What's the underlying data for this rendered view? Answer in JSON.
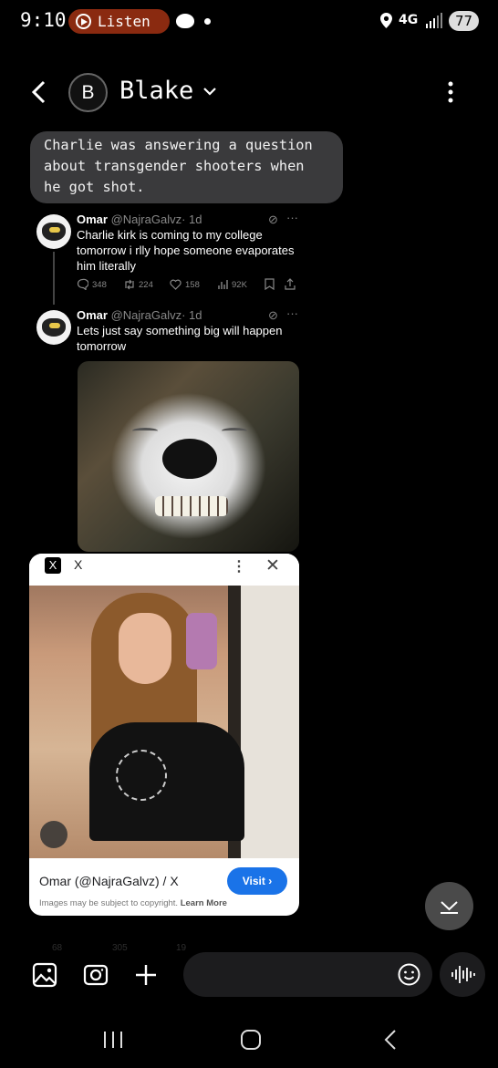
{
  "status_bar": {
    "time": "9:10",
    "listen_label": "Listen",
    "network": "4G",
    "battery": "77",
    "listen_color": "#8a2a10"
  },
  "header": {
    "avatar_letter": "B",
    "contact_name": "Blake"
  },
  "message": {
    "text": "Charlie was answering a question about transgender shooters when he got shot."
  },
  "tweets": [
    {
      "name": "Omar",
      "handle": "@NajraGalvz",
      "age": "· 1d",
      "text": "Charlie kirk is coming to my college tomorrow i rlly hope someone evaporates him literally",
      "replies": "348",
      "reposts": "224",
      "likes": "158",
      "views": "92K"
    },
    {
      "name": "Omar",
      "handle": "@NajraGalvz",
      "age": "· 1d",
      "text": "Lets just say something big will happen tomorrow"
    }
  ],
  "lens_card": {
    "logo": "X",
    "source": "X",
    "title": "Omar (@NajraGalvz) / X",
    "visit_label": "Visit ›",
    "copyright": "Images may be subject to copyright.",
    "learn_more": "Learn More"
  },
  "ghost_row": {
    "replies": "68",
    "reposts": "305",
    "likes": "19"
  },
  "icons": {
    "back": "chevron-left-icon",
    "more": "more-vertical-icon",
    "gallery": "gallery-icon",
    "camera": "camera-icon",
    "add": "plus-icon",
    "emoji": "emoji-icon",
    "voice": "voice-wave-icon"
  }
}
